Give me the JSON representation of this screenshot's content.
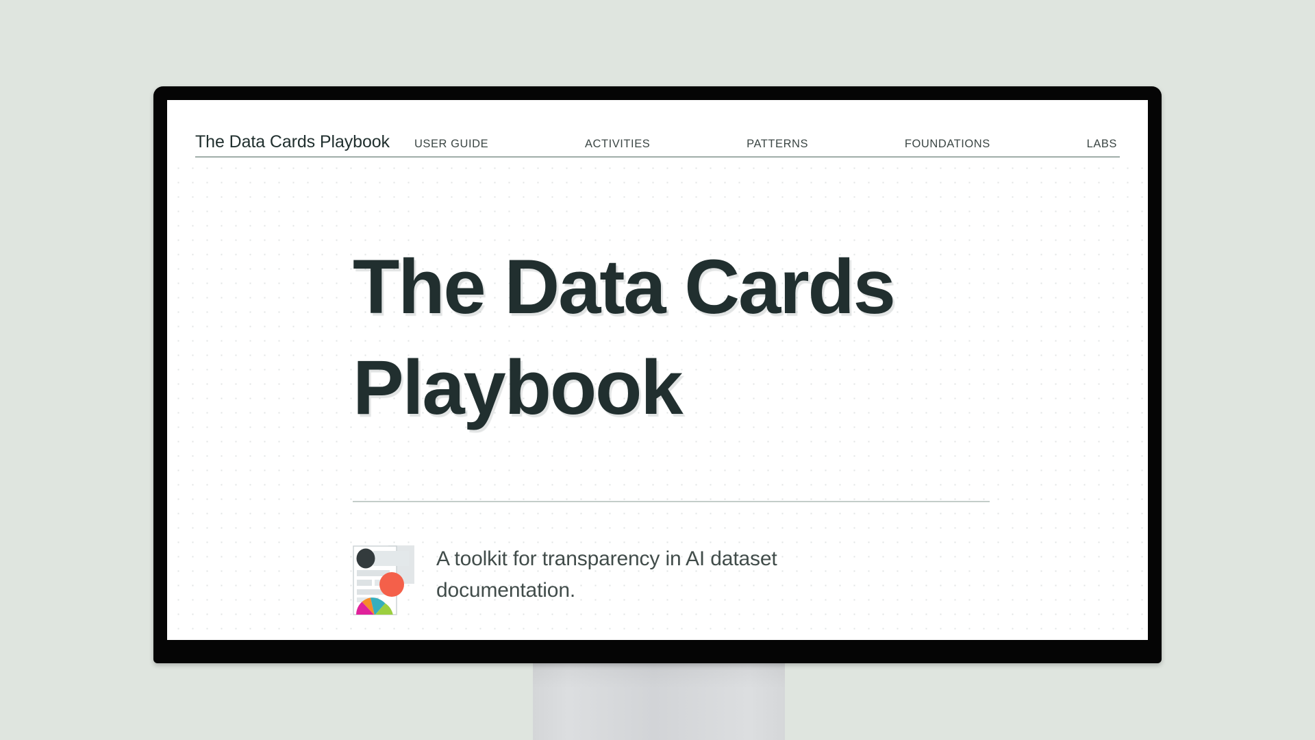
{
  "page": {
    "background_color": "#dfe5df",
    "screen_background": "#ffffff"
  },
  "device": {
    "type": "desktop-monitor",
    "bezel_color": "#050505",
    "stand_color": "#d6d8da"
  },
  "header": {
    "brand": "The Data Cards Playbook",
    "divider_color": "#9fada8",
    "nav": [
      {
        "label": "USER GUIDE",
        "name": "nav-user-guide"
      },
      {
        "label": "ACTIVITIES",
        "name": "nav-activities"
      },
      {
        "label": "PATTERNS",
        "name": "nav-patterns"
      },
      {
        "label": "FOUNDATIONS",
        "name": "nav-foundations"
      },
      {
        "label": "LABS",
        "name": "nav-labs"
      }
    ]
  },
  "hero": {
    "title": "The Data Cards Playbook",
    "title_color": "#212f2f",
    "tagline": "A toolkit for transparency in AI dataset documentation.",
    "tagline_color": "#414c4a",
    "divider_color": "#c3cdc9",
    "logo": {
      "name": "data-card-logo-icon",
      "card_color": "#ffffff",
      "card_border": "#c9cfd2",
      "shadow_block_color": "#e2e6e8",
      "placeholder_color": "#dde2e4",
      "dark_circle_color": "#333b3d",
      "coral_circle_color": "#f4604a",
      "arc_segments": [
        {
          "color": "#e0219a"
        },
        {
          "color": "#f68a28"
        },
        {
          "color": "#35aebd"
        },
        {
          "color": "#9ccf3f"
        }
      ]
    }
  }
}
